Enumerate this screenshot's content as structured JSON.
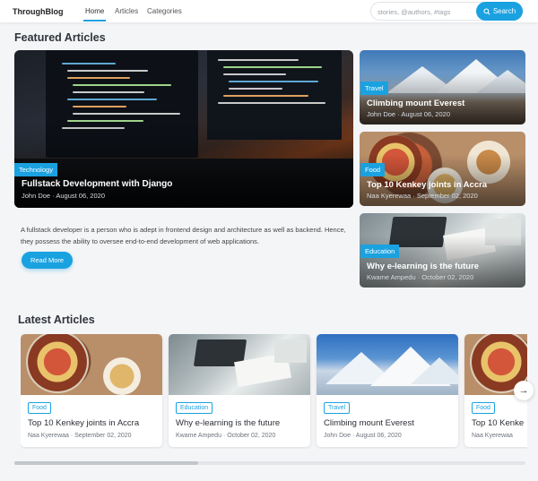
{
  "nav": {
    "brand": "ThroughBlog",
    "links": [
      {
        "label": "Home",
        "active": true
      },
      {
        "label": "Articles",
        "active": false
      },
      {
        "label": "Categories",
        "active": false
      }
    ],
    "search": {
      "placeholder": "stories, @authors, #tags",
      "button_label": "Search",
      "icon": "search-icon"
    }
  },
  "featured": {
    "title": "Featured Articles",
    "main": {
      "tag": "Technology",
      "title": "Fullstack Development with Django",
      "meta": "John Doe · August 06, 2020",
      "description": "A fullstack developer is a person who is adept in frontend design and architecture as well as backend. Hence, they possess the ability to oversee end-to-end development of web applications.",
      "read_more": "Read More"
    },
    "side": [
      {
        "tag": "Travel",
        "title": "Climbing mount Everest",
        "meta": "John Doe · August 06, 2020"
      },
      {
        "tag": "Food",
        "title": "Top 10 Kenkey joints in Accra",
        "meta": "Naa Kyerewaa · September 02, 2020"
      },
      {
        "tag": "Education",
        "title": "Why e-learning is the future",
        "meta": "Kwame Ampedu · October 02, 2020"
      }
    ]
  },
  "latest": {
    "title": "Latest Articles",
    "cards": [
      {
        "tag": "Food",
        "title": "Top 10 Kenkey joints in Accra",
        "meta": "Naa Kyerewaa · September 02, 2020"
      },
      {
        "tag": "Education",
        "title": "Why e-learning is the future",
        "meta": "Kwame Ampedu · October 02, 2020"
      },
      {
        "tag": "Travel",
        "title": "Climbing mount Everest",
        "meta": "John Doe · August 06, 2020"
      },
      {
        "tag": "Food",
        "title": "Top 10 Kenke",
        "meta": "Naa Kyerewaa"
      }
    ],
    "next_icon": "arrow-right-icon",
    "scroll_position": 0.36
  },
  "colors": {
    "accent": "#1aa1e0",
    "background": "#f4f5f7",
    "text": "#2b2f36"
  }
}
